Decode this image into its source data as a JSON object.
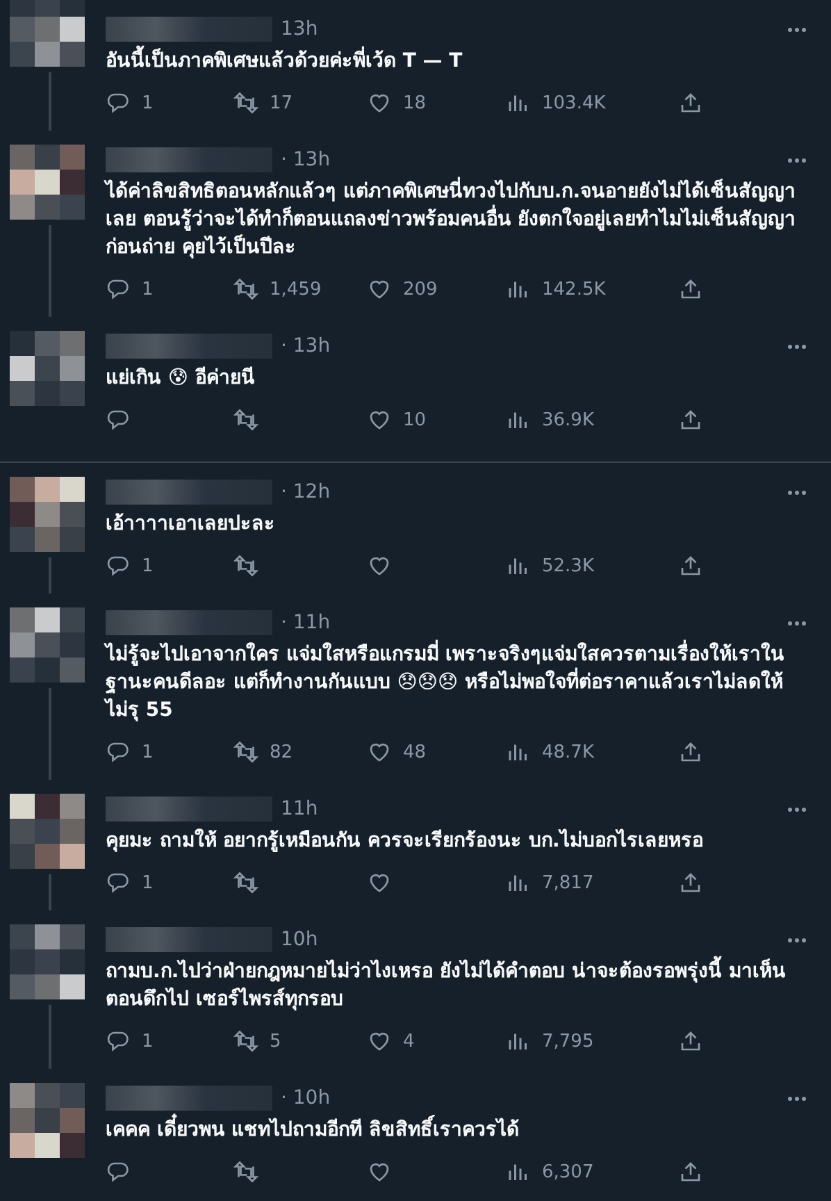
{
  "conversations": [
    {
      "replies": [
        {
          "time": "13h",
          "text": "อันนี้เป็นภาคพิเศษแล้วด้วยค่ะพี่เว้ด T — T",
          "replies": "1",
          "reposts": "17",
          "likes": "18",
          "views": "103.4K"
        },
        {
          "time": "· 13h",
          "text": "ได้ค่าลิขสิทธิตอนหลักแล้วๆ แต่ภาคพิเศษนี่ทวงไปกับบ.ก.จนอายยังไม่ได้เซ็นสัญญาเลย ตอนรู้ว่าจะได้ทำก็ตอนแถลงข่าวพร้อมคนอื่น ยังตกใจอยู่เลยทำไมไม่เซ็นสัญญาก่อนถ่าย คุยไว้เป็นปีละ",
          "replies": "1",
          "reposts": "1,459",
          "likes": "209",
          "views": "142.5K"
        },
        {
          "time": "· 13h",
          "text": "แย่เกิน 😰 อีค่ายนี",
          "likes": "10",
          "views": "36.9K"
        }
      ]
    },
    {
      "replies": [
        {
          "time": "· 12h",
          "text": "เอ้าาาาเอาเลยปะละ",
          "replies": "1",
          "views": "52.3K"
        },
        {
          "time": "· 11h",
          "text": "ไม่รู้จะไปเอาจากใคร แจ่มใสหรือแกรมมี่ เพราะจริงๆแจ่มใสควรตามเรื่องให้เราในฐานะคนดีลอะ แต่ก็ทำงานกันแบบ 😞😞😞  หรือไม่พอใจที่ต่อราคาแล้วเราไม่ลดให้ไม่รุ 55",
          "replies": "1",
          "reposts": "82",
          "likes": "48",
          "views": "48.7K"
        },
        {
          "time": "11h",
          "text": "คุยมะ ถามให้ อยากรู้เหมือนกัน ควรจะเรียกร้องนะ บก.ไม่บอกไรเลยหรอ",
          "replies": "1",
          "views": "7,817"
        },
        {
          "time": "10h",
          "text": "ถามบ.ก.ไปว่าฝ่ายกฎหมายไม่ว่าไงเหรอ ยังไม่ได้คำตอบ น่าจะต้องรอพรุ่งนี้ มาเห็นตอนดึกไป เซอร์ไพรส์ทุกรอบ",
          "replies": "1",
          "reposts": "5",
          "likes": "4",
          "views": "7,795"
        },
        {
          "time": "· 10h",
          "text": "เคคค เดี๋ยวพน แชทไปถามอีกที ลิขสิทธิ์เราควรได้",
          "views": "6,307"
        }
      ]
    }
  ]
}
